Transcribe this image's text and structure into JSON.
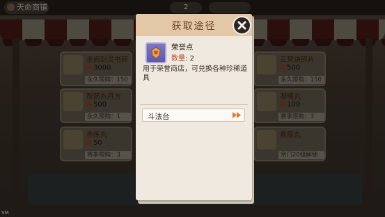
{
  "background": {
    "back_label": "天命商铺",
    "currency_count": "2",
    "shop_items": [
      {
        "name": "金阙封灵书碎",
        "price": "3000",
        "limit": "永久限购：150"
      },
      {
        "name": "帮筋丸丹方",
        "price": "500",
        "limit": "永久限购：1"
      },
      {
        "name": "赤炼丸",
        "price": "50",
        "limit": "赛季限购：3"
      },
      {
        "name": "三梵诀碎片",
        "price": "500",
        "limit": "永久限购：150"
      },
      {
        "name": "凝魄丸",
        "price": "100",
        "limit": "赛季限购：3"
      },
      {
        "name": "易筋丸",
        "price": "",
        "limit": "宗门20级解锁"
      }
    ],
    "corner_tag": "SM"
  },
  "dialog": {
    "title": "获取途径",
    "item_name": "荣誉点",
    "quantity_label": "数量:",
    "quantity_value": "2",
    "description": "用于荣誉商店，可兑换各种珍稀道具",
    "sources": [
      {
        "label": "斗法台"
      }
    ]
  },
  "colors": {
    "header": "#e3c7a6",
    "paper": "#efe9df",
    "accent": "#e07a2a"
  }
}
